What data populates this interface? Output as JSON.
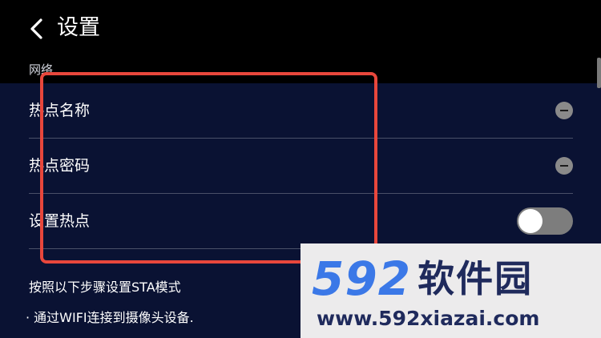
{
  "header": {
    "title": "设置",
    "back_icon": "chevron-left-icon"
  },
  "network": {
    "section_label": "网络",
    "rows": [
      {
        "label": "热点名称",
        "control": "minus-icon"
      },
      {
        "label": "热点密码",
        "control": "minus-icon"
      },
      {
        "label": "设置热点",
        "control": "toggle",
        "toggle_on": false
      }
    ]
  },
  "instructions": {
    "title": "按照以下步骤设置STA模式",
    "steps": [
      "· 通过WIFI连接到摄像头设备."
    ]
  },
  "watermark": {
    "logo_number": "592",
    "logo_text": "软件园",
    "url": "www.592xiazai.com"
  },
  "colors": {
    "header_bg": "#000000",
    "content_bg": "#0a1233",
    "divider": "#4a5068",
    "highlight": "#e8473c",
    "toggle_off": "#7d7d7d",
    "watermark_blue": "#3b78e7",
    "watermark_navy": "#1f2a5c"
  }
}
